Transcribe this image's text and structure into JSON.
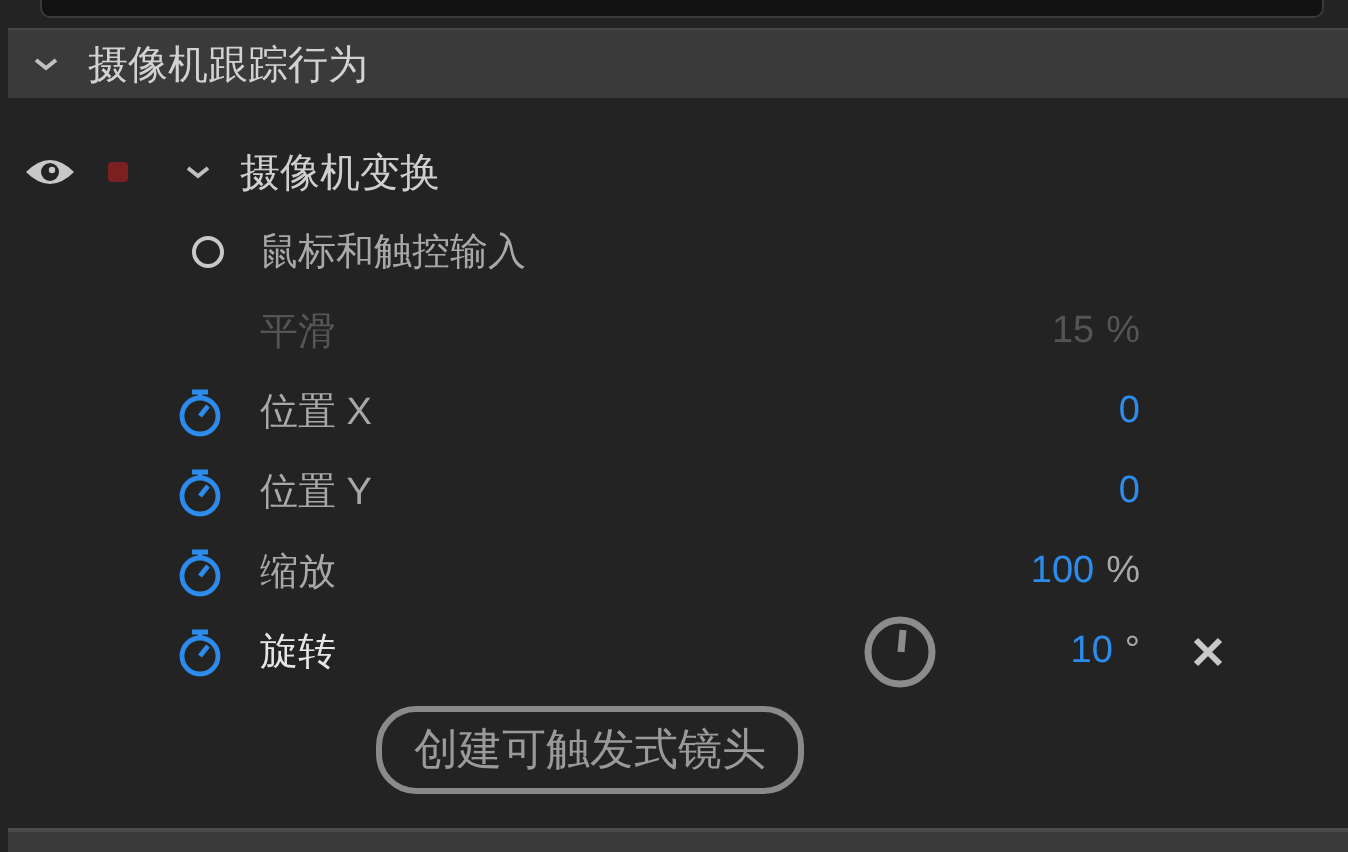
{
  "section": {
    "title": "摄像机跟踪行为",
    "expanded": true
  },
  "group": {
    "title": "摄像机变换",
    "visible": true,
    "record": true,
    "expanded": true
  },
  "rows": [
    {
      "kind": "radio",
      "label": "鼠标和触控输入",
      "checked": false
    },
    {
      "kind": "number",
      "label": "平滑",
      "value": "15",
      "unit": "%",
      "disabled": true,
      "selected": false
    },
    {
      "kind": "number",
      "label": "位置 X",
      "value": "0",
      "disabled": false,
      "selected": false
    },
    {
      "kind": "number",
      "label": "位置 Y",
      "value": "0",
      "disabled": false,
      "selected": false
    },
    {
      "kind": "number",
      "label": "缩放",
      "value": "100",
      "unit": "%",
      "disabled": false,
      "selected": false
    },
    {
      "kind": "angle",
      "label": "旋转",
      "value": "10",
      "unit": "°",
      "disabled": false,
      "selected": true
    }
  ],
  "button": {
    "label": "创建可触发式镜头"
  }
}
